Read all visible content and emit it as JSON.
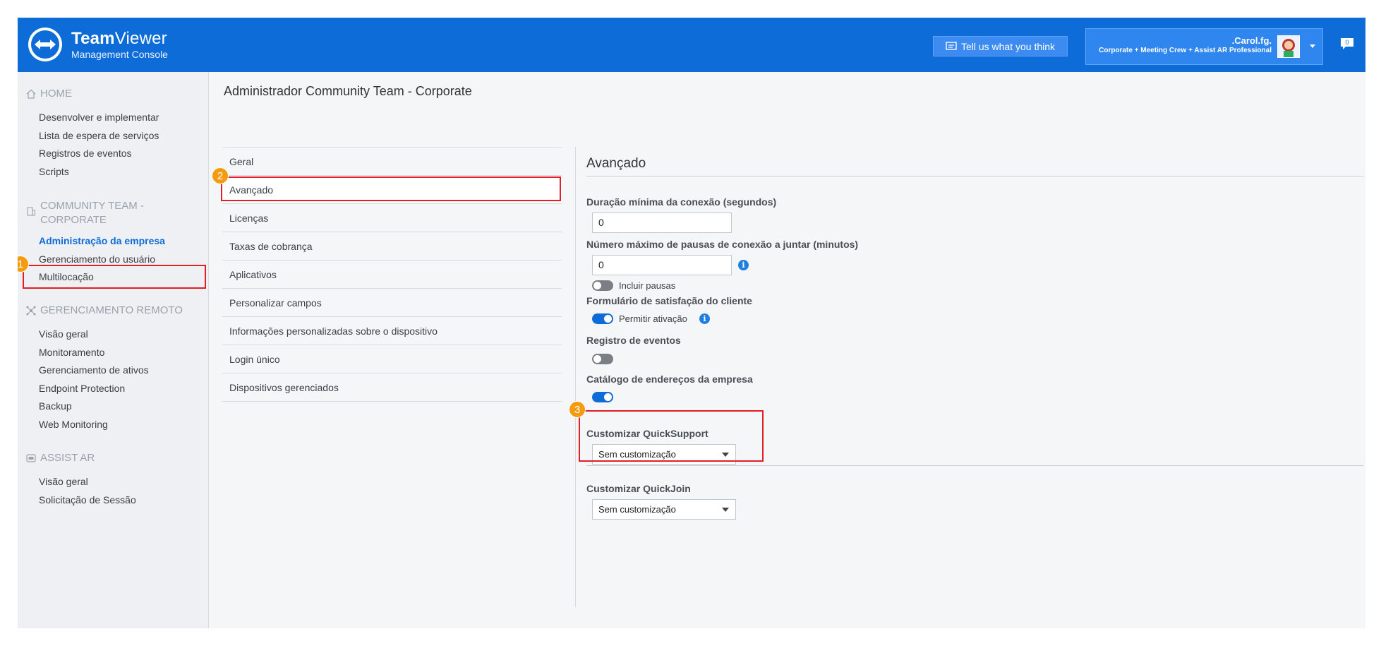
{
  "header": {
    "brand_strong": "Team",
    "brand_rest": "Viewer",
    "brand_sub": "Management Console",
    "feedback_label": "Tell us what you think",
    "user_name": ".Carol.fg.",
    "user_plan": "Corporate + Meeting Crew + Assist AR Professional",
    "notifications_count": "0",
    "brand_color": "#0e6cd8"
  },
  "sidebar": {
    "home": {
      "title": "HOME",
      "icon": "home-icon",
      "items": [
        "Desenvolver e implementar",
        "Lista de espera de serviços",
        "Registros de eventos",
        "Scripts"
      ]
    },
    "community": {
      "title": "COMMUNITY TEAM - CORPORATE",
      "icon": "building-icon",
      "items": [
        "Administração da empresa",
        "Gerenciamento do usuário",
        "Multilocação"
      ],
      "active_index": 0
    },
    "remote": {
      "title": "GERENCIAMENTO REMOTO",
      "icon": "network-icon",
      "items": [
        "Visão geral",
        "Monitoramento",
        "Gerenciamento de ativos",
        "Endpoint Protection",
        "Backup",
        "Web Monitoring"
      ]
    },
    "assist": {
      "title": "ASSIST AR",
      "icon": "headset-icon",
      "items": [
        "Visão geral",
        "Solicitação de Sessão"
      ]
    }
  },
  "main": {
    "page_title": "Administrador Community Team - Corporate",
    "tabs": [
      "Geral",
      "Avançado",
      "Licenças",
      "Taxas de cobrança",
      "Aplicativos",
      "Personalizar campos",
      "Informações personalizadas sobre o dispositivo",
      "Login único",
      "Dispositivos gerenciados"
    ],
    "active_tab_index": 1
  },
  "advanced": {
    "title": "Avançado",
    "min_duration": {
      "label": "Duração mínima da conexão (segundos)",
      "value": "0"
    },
    "max_pauses": {
      "label": "Número máximo de pausas de conexão a juntar (minutos)",
      "value": "0",
      "toggle_label": "Incluir pausas",
      "toggle_on": false
    },
    "satisfaction": {
      "label": "Formulário de satisfação do cliente",
      "toggle_label": "Permitir ativação",
      "toggle_on": true
    },
    "event_log": {
      "label": "Registro de eventos",
      "toggle_on": false
    },
    "address_book": {
      "label": "Catálogo de endereços da empresa",
      "toggle_on": true
    },
    "quicksupport": {
      "label": "Customizar QuickSupport",
      "selected": "Sem customização"
    },
    "quickjoin": {
      "label": "Customizar QuickJoin",
      "selected": "Sem customização"
    }
  },
  "annotations": {
    "badge1": "1",
    "badge2": "2",
    "badge3": "3",
    "highlight_color": "#e41e26",
    "badge_color": "#f39c12"
  }
}
